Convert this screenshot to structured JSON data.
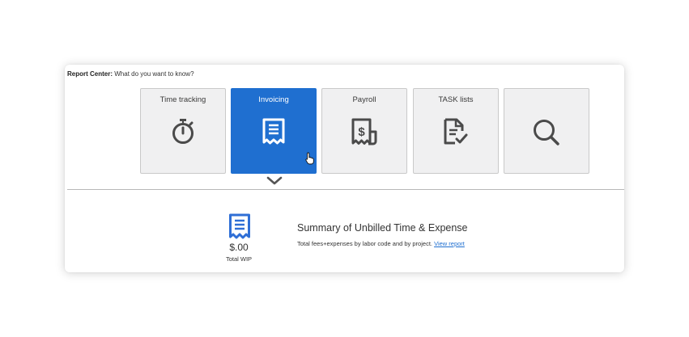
{
  "header": {
    "bold_label": "Report Center:",
    "question": "What do you want to know?"
  },
  "tiles": [
    {
      "label": "Time tracking",
      "icon": "stopwatch-icon"
    },
    {
      "label": "Invoicing",
      "icon": "receipt-icon",
      "selected": true
    },
    {
      "label": "Payroll",
      "icon": "payroll-receipt-icon"
    },
    {
      "label": "TASK lists",
      "icon": "task-list-icon"
    },
    {
      "label": "",
      "icon": "search-icon"
    }
  ],
  "summary": {
    "amount": "$.00",
    "amount_label": "Total WIP",
    "title": "Summary of Unbilled Time & Expense",
    "description": "Total fees+expenses by labor code and by project.",
    "link": "View report"
  },
  "colors": {
    "accent": "#1f6fd0",
    "tile_bg": "#f0f0f1",
    "icon_gray": "#4a4a4a"
  }
}
